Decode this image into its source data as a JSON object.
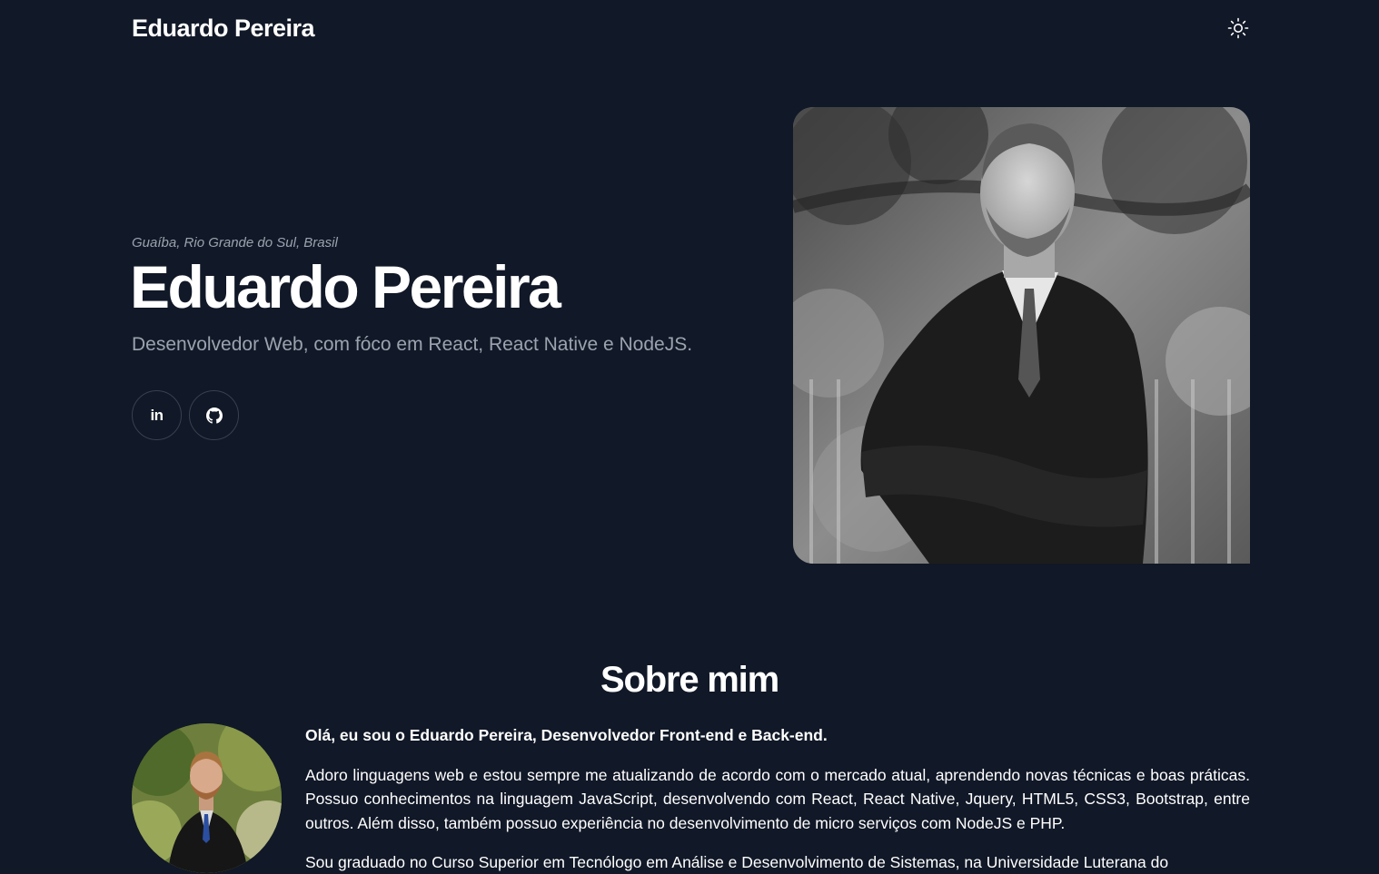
{
  "header": {
    "site_title": "Eduardo Pereira",
    "theme_icon": "sun-icon"
  },
  "hero": {
    "location": "Guaíba, Rio Grande do Sul, Brasil",
    "name": "Eduardo Pereira",
    "role": "Desenvolvedor Web, com fóco em React, React Native e NodeJS.",
    "social": [
      {
        "icon": "linkedin-icon",
        "label": "in"
      },
      {
        "icon": "github-icon"
      }
    ]
  },
  "about": {
    "title": "Sobre mim",
    "intro": "Olá, eu sou o Eduardo Pereira, Desenvolvedor Front-end e Back-end.",
    "paragraph1": "Adoro linguagens web e estou sempre me atualizando de acordo com o mercado atual, aprendendo novas técnicas e boas práticas. Possuo conhecimentos na linguagem JavaScript, desenvolvendo com React, React Native, Jquery, HTML5, CSS3, Bootstrap, entre outros. Além disso, também possuo experiência no desenvolvimento de micro serviços com NodeJS e PHP.",
    "paragraph2": "Sou graduado no Curso Superior em Tecnólogo em Análise e Desenvolvimento de Sistemas, na Universidade Luterana do"
  },
  "colors": {
    "background": "#111827",
    "muted_text": "#9ca3af",
    "border": "#374151"
  }
}
